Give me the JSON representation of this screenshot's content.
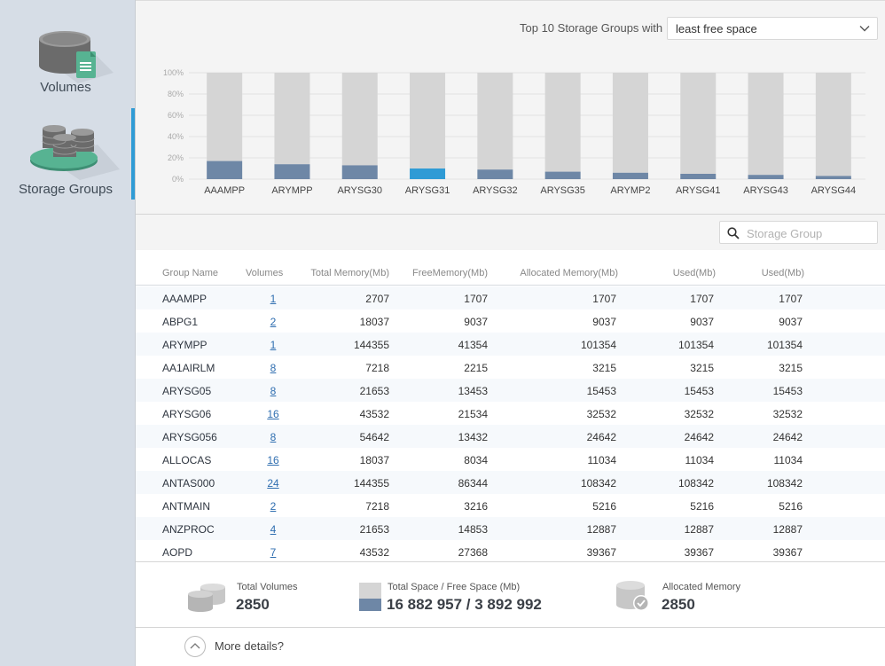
{
  "sidebar": {
    "items": [
      {
        "label": "Volumes",
        "icon": "volume-doc-icon"
      },
      {
        "label": "Storage Groups",
        "icon": "storage-groups-icon"
      }
    ]
  },
  "filter": {
    "label": "Top 10 Storage Groups with",
    "selected": "least free space"
  },
  "chart_data": {
    "type": "bar",
    "stacked": true,
    "categories": [
      "AAAMPP",
      "ARYMPP",
      "ARYSG30",
      "ARYSG31",
      "ARYSG32",
      "ARYSG35",
      "ARYMP2",
      "ARYSG41",
      "ARYSG43",
      "ARYSG44"
    ],
    "y_ticks": [
      "0%",
      "20%",
      "40%",
      "60%",
      "80%",
      "100%"
    ],
    "ylim": [
      0,
      100
    ],
    "series": [
      {
        "values": [
          17,
          14,
          13,
          10,
          9,
          7,
          6,
          5,
          4,
          3
        ],
        "color": "#6e87a6",
        "highlight_color": "#2f9bd5",
        "highlight_index": 3
      },
      {
        "values": [
          83,
          86,
          87,
          90,
          91,
          93,
          94,
          95,
          96,
          97
        ],
        "color": "#d5d5d5"
      }
    ],
    "grid": true
  },
  "search": {
    "placeholder": "Storage Group"
  },
  "table": {
    "headers": [
      "Group Name",
      "Volumes",
      "Total Memory(Mb)",
      "FreeMemory(Mb)",
      "Allocated Memory(Mb)",
      "Used(Mb)",
      "Used(Mb)"
    ],
    "rows": [
      [
        "AAAMPP",
        "1",
        "2707",
        "1707",
        "1707",
        "1707",
        "1707"
      ],
      [
        "ABPG1",
        "2",
        "18037",
        "9037",
        "9037",
        "9037",
        "9037"
      ],
      [
        "ARYMPP",
        "1",
        "144355",
        "41354",
        "101354",
        "101354",
        "101354"
      ],
      [
        "AA1AIRLM",
        "8",
        "7218",
        "2215",
        "3215",
        "3215",
        "3215"
      ],
      [
        "ARYSG05",
        "8",
        "21653",
        "13453",
        "15453",
        "15453",
        "15453"
      ],
      [
        "ARYSG06",
        "16",
        "43532",
        "21534",
        "32532",
        "32532",
        "32532"
      ],
      [
        "ARYSG056",
        "8",
        "54642",
        "13432",
        "24642",
        "24642",
        "24642"
      ],
      [
        "ALLOCAS",
        "16",
        "18037",
        "8034",
        "11034",
        "11034",
        "11034"
      ],
      [
        "ANTAS000",
        "24",
        "144355",
        "86344",
        "108342",
        "108342",
        "108342"
      ],
      [
        "ANTMAIN",
        "2",
        "7218",
        "3216",
        "5216",
        "5216",
        "5216"
      ],
      [
        "ANZPROC",
        "4",
        "21653",
        "14853",
        "12887",
        "12887",
        "12887"
      ],
      [
        "AOPD",
        "7",
        "43532",
        "27368",
        "39367",
        "39367",
        "39367"
      ]
    ]
  },
  "summary": {
    "total_volumes_label": "Total Volumes",
    "total_volumes_value": "2850",
    "space_label": "Total Space / Free Space (Mb)",
    "space_value": "16 882 957 / 3 892 992",
    "allocated_label": "Allocated Memory",
    "allocated_value": "2850"
  },
  "more": {
    "label": "More details?"
  }
}
